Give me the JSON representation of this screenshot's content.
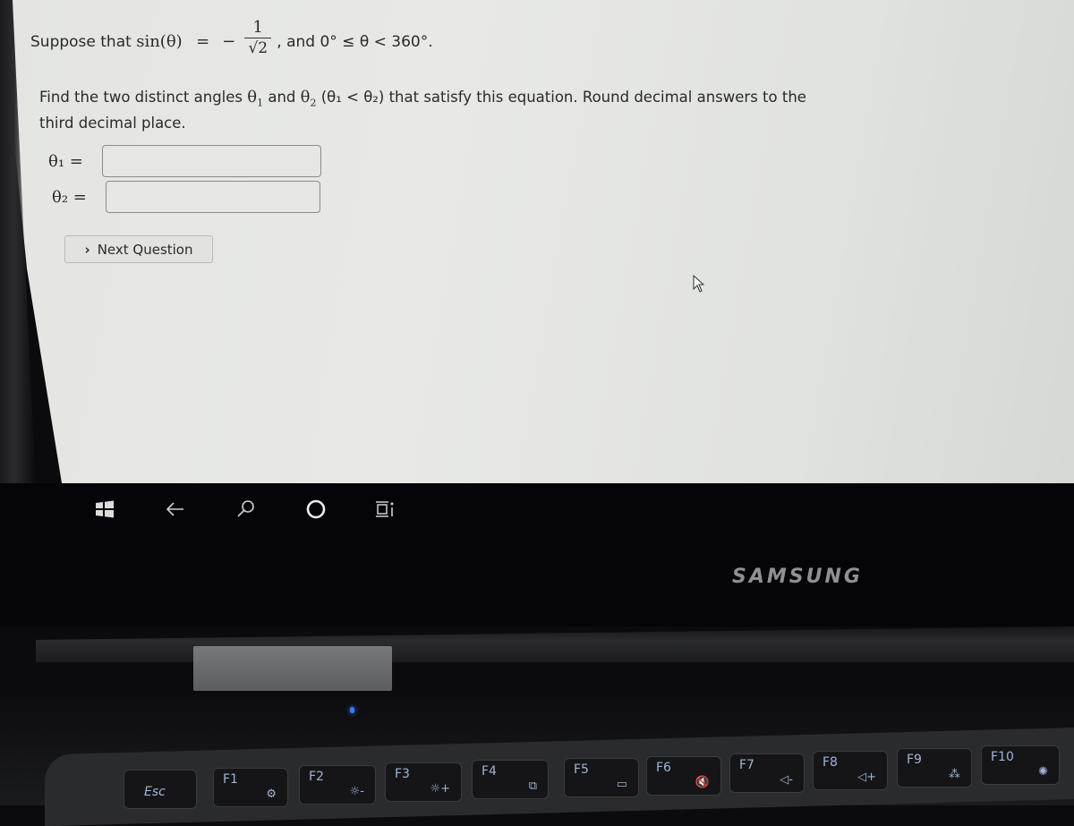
{
  "question": {
    "intro": "Suppose that",
    "func": "sin(θ)",
    "equals": "=",
    "minus": "−",
    "frac_num": "1",
    "frac_den": "√2",
    "condition": ", and 0° ≤ θ < 360°.",
    "instruction_a": "Find the two distinct angles ",
    "theta1": "θ",
    "sub1": "1",
    "and": " and ",
    "theta2": "θ",
    "sub2": "2",
    "paren": " (θ₁ < θ₂) that satisfy this equation. Round decimal answers to the third decimal place."
  },
  "answers": [
    {
      "label": "θ₁ =",
      "value": "",
      "placeholder": ""
    },
    {
      "label": "θ₂ =",
      "value": "",
      "placeholder": ""
    }
  ],
  "next_button": {
    "label": "Next Question",
    "chevron": "›"
  },
  "taskbar": {
    "icons": [
      "windows-start-icon",
      "back-arrow-icon",
      "search-icon",
      "cortana-circle-icon",
      "task-view-icon"
    ]
  },
  "brand": "SAMSUNG",
  "keyboard": {
    "keys": [
      {
        "label": "Esc",
        "icon": ""
      },
      {
        "label": "F1",
        "icon": "⚙"
      },
      {
        "label": "F2",
        "icon": "☼-"
      },
      {
        "label": "F3",
        "icon": "☼+"
      },
      {
        "label": "F4",
        "icon": "⧉"
      },
      {
        "label": "F5",
        "icon": "▭"
      },
      {
        "label": "F6",
        "icon": "🔇"
      },
      {
        "label": "F7",
        "icon": "◁-"
      },
      {
        "label": "F8",
        "icon": "◁+"
      },
      {
        "label": "F9",
        "icon": "⁂"
      },
      {
        "label": "F10",
        "icon": "✺"
      }
    ]
  }
}
